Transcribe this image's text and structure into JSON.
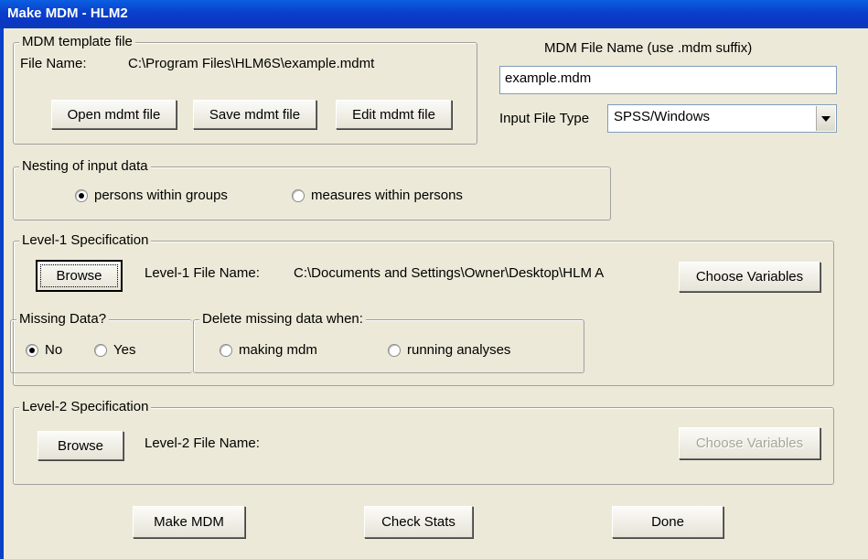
{
  "window": {
    "title": "Make MDM - HLM2"
  },
  "template_group": {
    "legend": "MDM template file",
    "file_name_label": "File Name:",
    "file_name_value": "C:\\Program Files\\HLM6S\\example.mdmt",
    "open_label": "Open mdmt file",
    "save_label": "Save mdmt file",
    "edit_label": "Edit mdmt file"
  },
  "mdm_file": {
    "label": "MDM File Name (use .mdm suffix)",
    "value": "example.mdm"
  },
  "input_type": {
    "label": "Input File Type",
    "selected": "SPSS/Windows"
  },
  "nesting": {
    "legend": "Nesting of input data",
    "option1": "persons within groups",
    "option2": "measures within persons",
    "selected": 1
  },
  "level1": {
    "legend": "Level-1 Specification",
    "browse_label": "Browse",
    "file_label": "Level-1 File Name:",
    "file_value": "C:\\Documents and Settings\\Owner\\Desktop\\HLM A",
    "choose_label": "Choose Variables",
    "missing_legend": "Missing Data?",
    "missing_no": "No",
    "missing_yes": "Yes",
    "delete_legend": "Delete missing data when:",
    "delete_opt1": "making mdm",
    "delete_opt2": "running analyses"
  },
  "level2": {
    "legend": "Level-2 Specification",
    "browse_label": "Browse",
    "file_label": "Level-2 File Name:",
    "choose_label": "Choose Variables"
  },
  "footer": {
    "make_label": "Make MDM",
    "check_label": "Check Stats",
    "done_label": "Done"
  }
}
